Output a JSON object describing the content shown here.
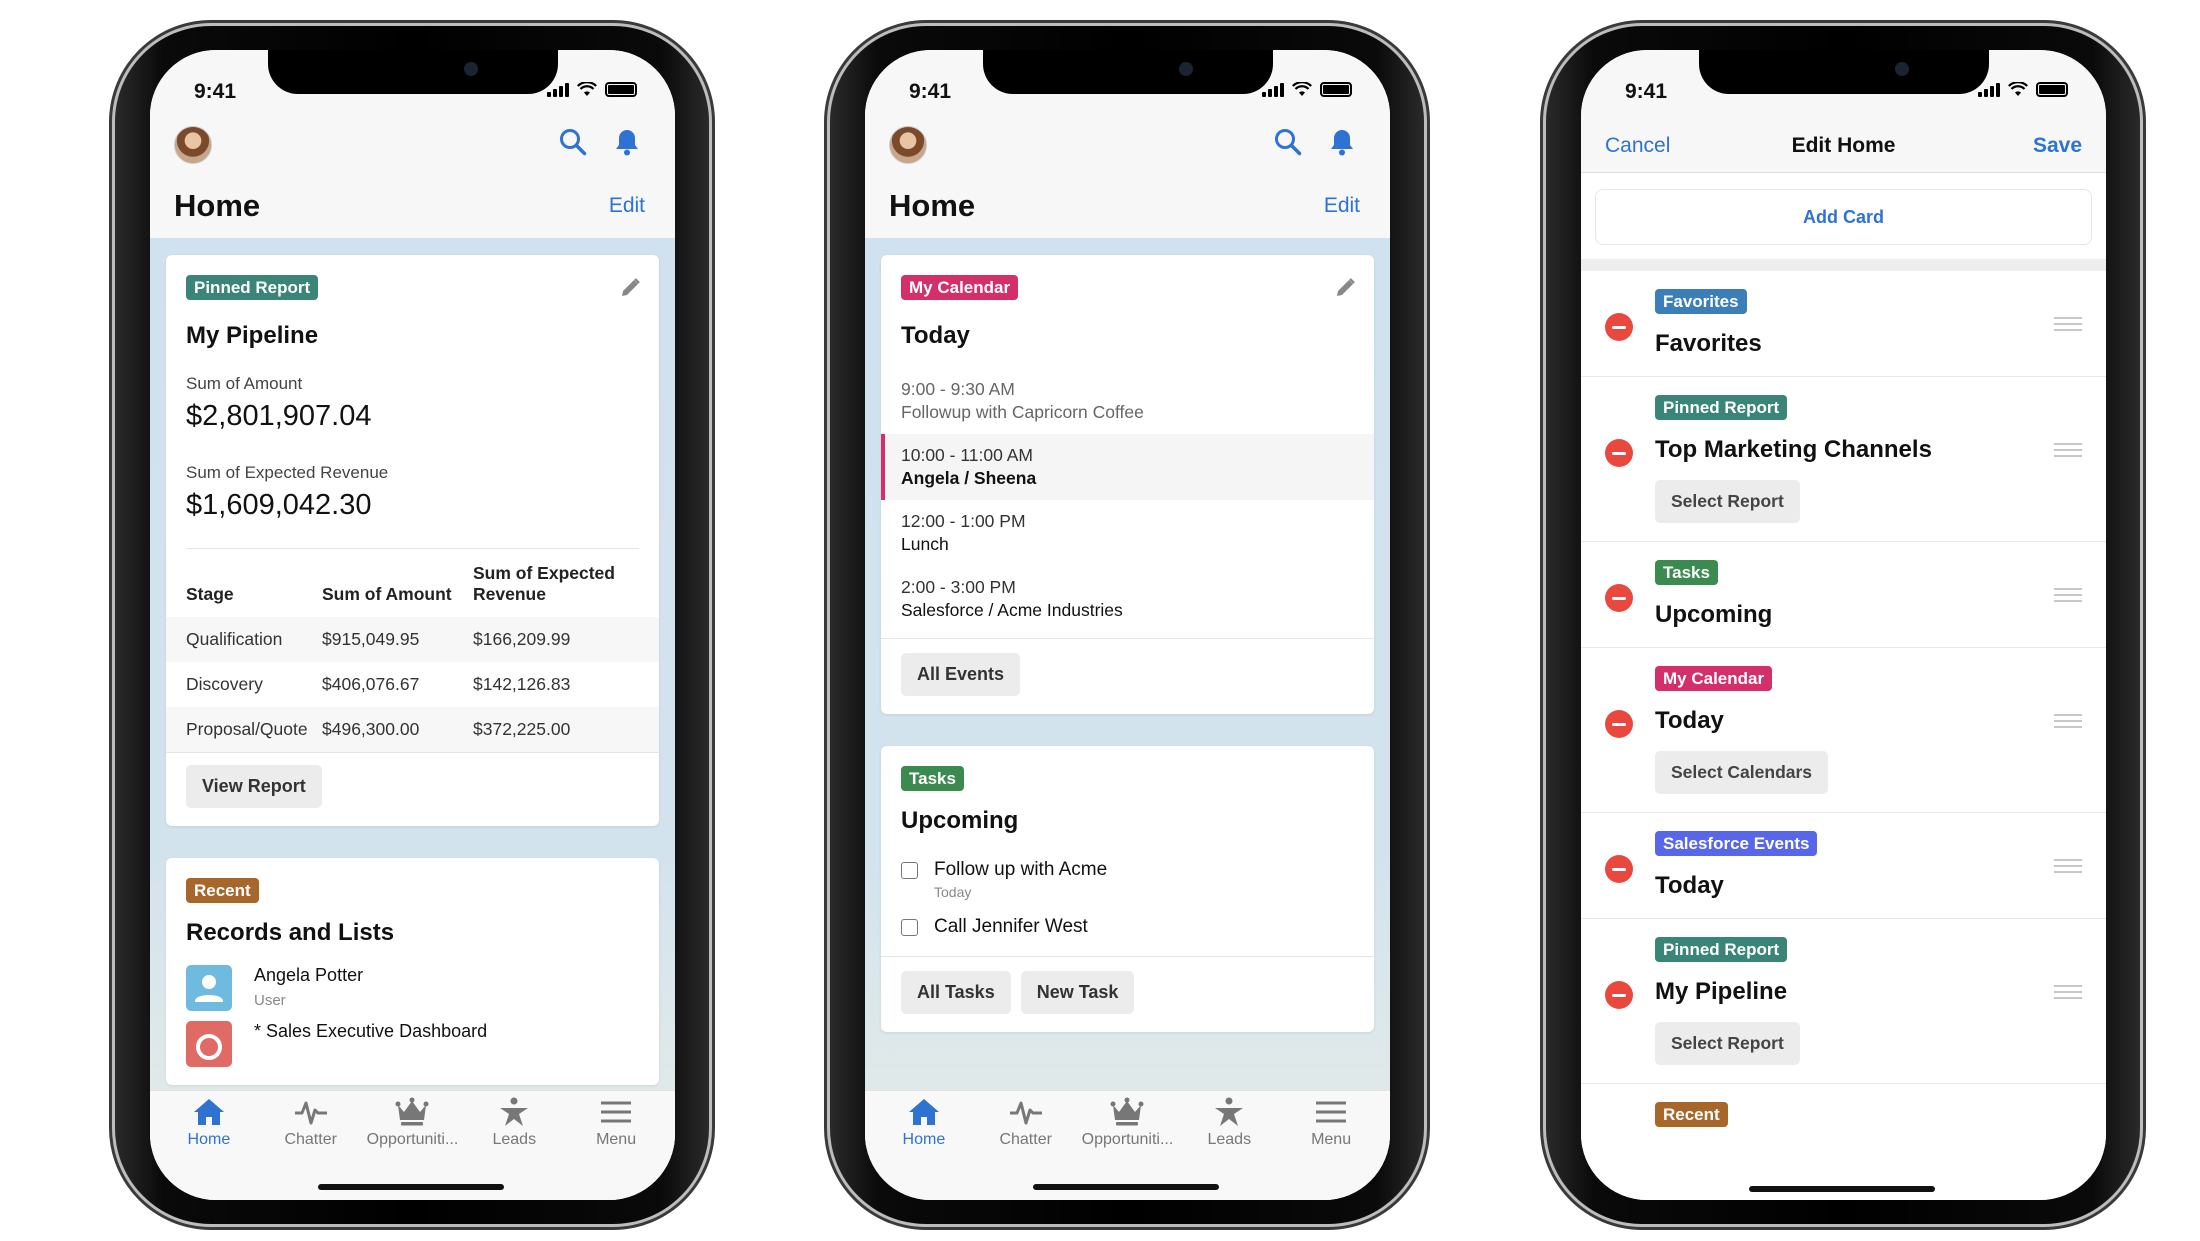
{
  "status": {
    "time": "9:41"
  },
  "colors": {
    "accent": "#2e72d2",
    "pinned_report": "#3a8577",
    "my_calendar": "#d32f6b",
    "tasks": "#3b8a4f",
    "recent": "#a8672a",
    "favorites": "#3c7fb8",
    "salesforce_events": "#5867e8",
    "remove": "#e8483d"
  },
  "tabbar": {
    "items": [
      {
        "label": "Home",
        "icon": "home-icon",
        "active": true
      },
      {
        "label": "Chatter",
        "icon": "pulse-icon"
      },
      {
        "label": "Opportuniti...",
        "icon": "crown-icon"
      },
      {
        "label": "Leads",
        "icon": "star-person-icon"
      },
      {
        "label": "Menu",
        "icon": "menu-icon"
      }
    ]
  },
  "home": {
    "title": "Home",
    "edit_label": "Edit"
  },
  "pipeline": {
    "badge": "Pinned Report",
    "title": "My Pipeline",
    "sum_amount_label": "Sum of Amount",
    "sum_amount": "$2,801,907.04",
    "sum_expected_label": "Sum of Expected Revenue",
    "sum_expected": "$1,609,042.30",
    "columns": [
      "Stage",
      "Sum of Amount",
      "Sum of Expected Revenue"
    ],
    "rows": [
      [
        "Qualification",
        "$915,049.95",
        "$166,209.99"
      ],
      [
        "Discovery",
        "$406,076.67",
        "$142,126.83"
      ],
      [
        "Proposal/Quote",
        "$496,300.00",
        "$372,225.00"
      ]
    ],
    "button": "View Report"
  },
  "recent": {
    "badge": "Recent",
    "title": "Records and Lists",
    "items": [
      {
        "name": "Angela Potter",
        "type": "User"
      },
      {
        "name": "* Sales Executive Dashboard"
      }
    ]
  },
  "calendar": {
    "badge": "My Calendar",
    "title": "Today",
    "events": [
      {
        "time": "9:00 - 9:30 AM",
        "name": "Followup with Capricorn Coffee"
      },
      {
        "time": "10:00 - 11:00 AM",
        "name": "Angela / Sheena"
      },
      {
        "time": "12:00 - 1:00 PM",
        "name": "Lunch"
      },
      {
        "time": "2:00 - 3:00 PM",
        "name": "Salesforce / Acme Industries"
      }
    ],
    "button": "All Events"
  },
  "tasks": {
    "badge": "Tasks",
    "title": "Upcoming",
    "items": [
      {
        "name": "Follow up with Acme",
        "due": "Today"
      },
      {
        "name": "Call Jennifer West"
      }
    ],
    "buttons": [
      "All Tasks",
      "New Task"
    ]
  },
  "edit": {
    "cancel": "Cancel",
    "title": "Edit Home",
    "save": "Save",
    "add_card": "Add Card",
    "rows": [
      {
        "badge": "Favorites",
        "title": "Favorites"
      },
      {
        "badge": "Pinned Report",
        "title": "Top Marketing Channels",
        "button": "Select Report"
      },
      {
        "badge": "Tasks",
        "title": "Upcoming"
      },
      {
        "badge": "My Calendar",
        "title": "Today",
        "button": "Select Calendars"
      },
      {
        "badge": "Salesforce Events",
        "title": "Today"
      },
      {
        "badge": "Pinned Report",
        "title": "My Pipeline",
        "button": "Select Report"
      },
      {
        "badge": "Recent"
      }
    ]
  }
}
